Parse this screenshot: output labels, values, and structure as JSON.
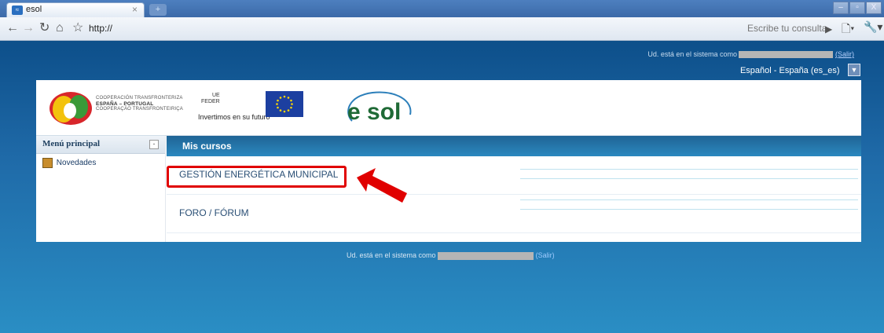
{
  "browser": {
    "tab_title": "esol",
    "tab_close": "×",
    "new_tab": "+",
    "address": "http://",
    "search_placeholder": "Escribe tu consulta",
    "window_controls": [
      "–",
      "▫",
      "X"
    ]
  },
  "page": {
    "logged_in_prefix": "Ud. está en el sistema como",
    "logout_label": "(Salir)",
    "language": "Español - España (es_es)",
    "header": {
      "poctep_lines": [
        "COOPERACIÓN TRANSFRONTERIZA",
        "ESPAÑA – PORTUGAL",
        "COOPERAÇÃO TRANSFRONTEIRIÇA"
      ],
      "ue_lines": [
        "UE",
        "FEDER"
      ],
      "invest_text": "Invertimos en su futuro",
      "logo_text": "e sol"
    },
    "sidebar": {
      "title": "Menú principal",
      "toggle": "-",
      "items": [
        {
          "label": "Novedades"
        }
      ]
    },
    "main": {
      "title": "Mis cursos",
      "courses": [
        {
          "label": "GESTIÓN ENERGÉTICA MUNICIPAL"
        },
        {
          "label": "FORO / FÓRUM"
        }
      ]
    },
    "footer": {
      "logged_in_prefix": "Ud. está en el sistema como",
      "logout_label": "(Salir)"
    }
  },
  "colors": {
    "highlight": "#e00000",
    "content_header": "#2b88bf"
  }
}
